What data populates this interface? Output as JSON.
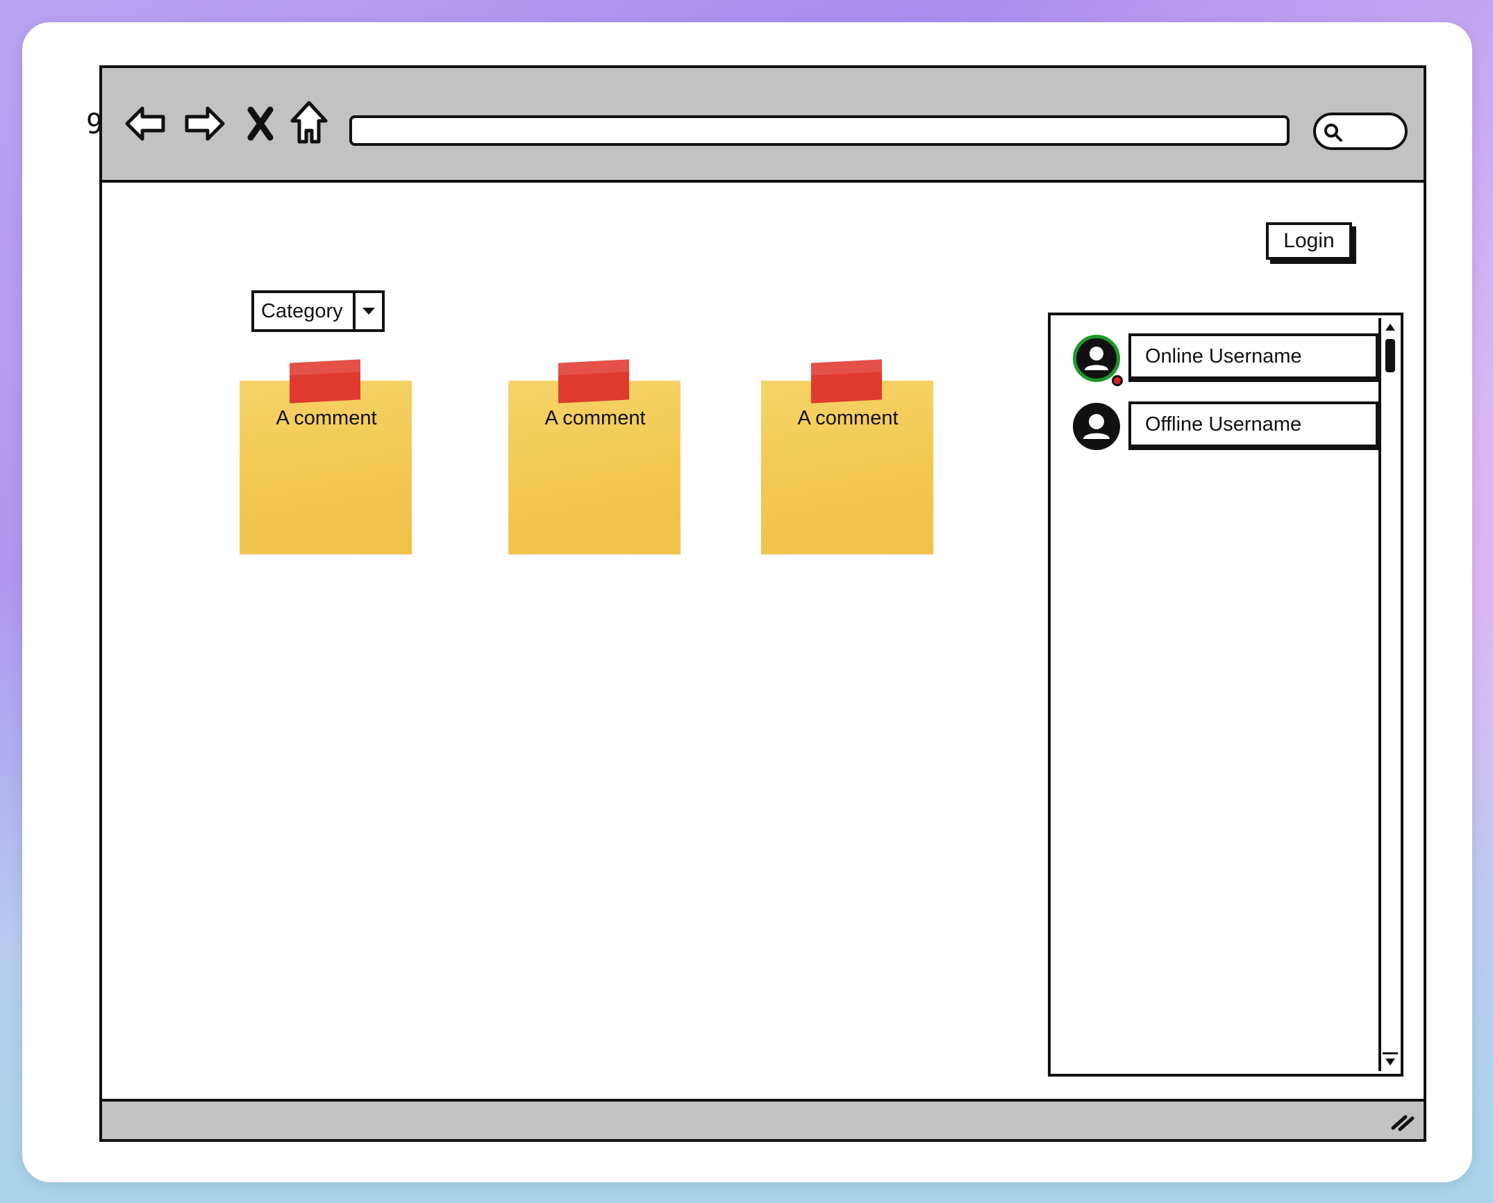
{
  "page_number": "9",
  "browser": {
    "nav_icons": [
      "back-arrow-icon",
      "forward-arrow-icon",
      "close-x-icon",
      "home-icon"
    ],
    "search_icon": "search-icon"
  },
  "header": {
    "login_label": "Login"
  },
  "filter": {
    "category_label": "Category"
  },
  "notes": [
    {
      "text": "A comment"
    },
    {
      "text": "A comment"
    },
    {
      "text": "A comment"
    }
  ],
  "users": [
    {
      "name": "Online Username",
      "status": "online"
    },
    {
      "name": "Offline Username",
      "status": "offline"
    }
  ],
  "colors": {
    "note_yellow": "#f2c850",
    "tape_red": "#e03a2f",
    "online_ring": "#1a9a2b",
    "status_dot": "#d42020",
    "chrome_gray": "#c2c2c2"
  }
}
